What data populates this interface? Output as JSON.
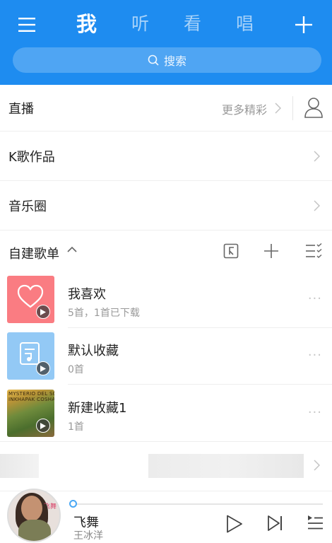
{
  "header": {
    "tabs": [
      {
        "label": "我",
        "active": true
      },
      {
        "label": "听",
        "active": false
      },
      {
        "label": "看",
        "active": false
      },
      {
        "label": "唱",
        "active": false
      }
    ],
    "search_placeholder": "搜索",
    "menu_icon": "menu-icon",
    "add_icon": "plus-icon",
    "accent_color": "#1e8cf0"
  },
  "rows": {
    "live": {
      "label": "直播",
      "more": "更多精彩"
    },
    "k_songs": {
      "label": "K歌作品"
    },
    "music_circle": {
      "label": "音乐圈"
    }
  },
  "section": {
    "title": "自建歌单"
  },
  "playlists": [
    {
      "name": "我喜欢",
      "subtitle": "5首，1首已下载",
      "cover": "heart-icon"
    },
    {
      "name": "默认收藏",
      "subtitle": "0首",
      "cover": "music-note-icon"
    },
    {
      "name": "新建收藏1",
      "subtitle": "1首",
      "cover_text": "MYSTERIO DEL SOL\nINKHAPAK COSHA"
    }
  ],
  "player": {
    "song": "飞舞",
    "artist": "王冰洋",
    "disc_text": "飞舞",
    "progress": 0.0
  }
}
